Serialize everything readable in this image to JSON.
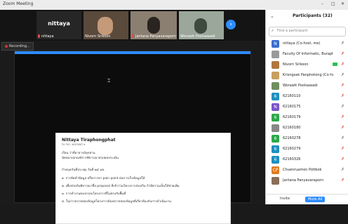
{
  "window": {
    "title": "Zoom Meeting"
  },
  "thumbnails": [
    {
      "name": "nittaya",
      "label": "nittaya",
      "muted": true
    },
    {
      "name": "Nivorn Srikoon",
      "muted": false
    },
    {
      "name": "Jantana Panyavaraporn",
      "muted": true
    },
    {
      "name": "Worawit Poolsawadi",
      "muted": false
    }
  ],
  "recording": {
    "label": "Recording..."
  },
  "email": {
    "from": "Nittaya Tiraphongphat",
    "to": "to me, worawit ▾",
    "lines": [
      "เรียน ว่าที่อาจารย์ทุกท่าน",
      "นัดหมายเกณฑ์การพิจารณาสรุปผลประเมิน",
      "",
      "กำหนดวันที่ประชุม วันที่ ๒๔ มค.",
      "๑. การจัดทำข้อมูล หรือการหา pain point ต่อการเก็บข้อมูลให้",
      "๒. เพื่อช่วยกันพิจารณาชื่อ proposal ที่เข้าร่วมโครงการส่งเสริม ถ้ามีความเห็นให้ช่วยเพิ่ม",
      "๓. การทำงานของกรอบโครงการที่ไม่ตรงกับพื้นที่",
      "๔. ในการตรวจสอบข้อมูลโครงการต้องตรวจสอบข้อมูลที่เกี่ยวข้องกับการดำเนินงาน"
    ]
  },
  "panel": {
    "title": "Participants (32)",
    "search_placeholder": "Find a participant",
    "participants": [
      {
        "initial": "N",
        "name": "nittaya (Co-host, me)",
        "color": "#3b6fcf"
      },
      {
        "initial": "",
        "name": "Faculty Of Informatic, Burapha Uni...",
        "color": "#9a9a9a"
      },
      {
        "initial": "",
        "name": "Nivorn Srikoon",
        "color": "#b07840"
      },
      {
        "initial": "",
        "name": "Krisngsak Panphotong (Co-host)",
        "color": "#c8a060"
      },
      {
        "initial": "",
        "name": "Worawit Poolsawadi",
        "color": "#6f8f5f"
      },
      {
        "initial": "6",
        "name": "62160110",
        "color": "#1f8fbf"
      },
      {
        "initial": "N",
        "name": "62160175",
        "color": "#7a55c9"
      },
      {
        "initial": "6",
        "name": "62160179",
        "color": "#2aa84a"
      },
      {
        "initial": "",
        "name": "62160180",
        "color": "#888888"
      },
      {
        "initial": "6",
        "name": "62160278",
        "color": "#2aa84a"
      },
      {
        "initial": "6",
        "name": "62160279",
        "color": "#1f8fbf"
      },
      {
        "initial": "6",
        "name": "62160326",
        "color": "#1f8fbf"
      },
      {
        "initial": "CP",
        "name": "Chuenruamon Poltbok",
        "color": "#e07b20"
      },
      {
        "initial": "",
        "name": "Jantana Panyavaraporn",
        "color": "#8a6f5a"
      }
    ],
    "footer": {
      "invite": "Invite",
      "mute_all": "Mute All"
    }
  }
}
